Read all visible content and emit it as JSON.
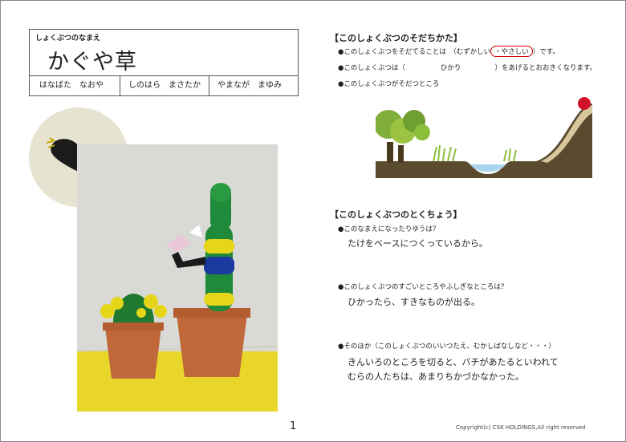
{
  "name_caption": "しょくぶつのなまえ",
  "plant_name": "かぐや草",
  "authors": [
    "はなばた　なおや",
    "しのはら　まさたか",
    "やまなが　まゆみ"
  ],
  "growth": {
    "heading": "【このしょくぶつのそだちかた】",
    "q1_prefix": "●このしょくぶつをそだてることは　（むずかしい",
    "q1_choice": "・やさしい",
    "q1_suffix": "）です。",
    "q2_prefix": "●このしょくぶつは（",
    "q2_answer": "ひかり",
    "q2_suffix": "）をあげるとおおきくなります。",
    "q3": "●このしょくぶつがそだつところ"
  },
  "features": {
    "heading": "【このしょくぶつのとくちょう】",
    "q1": "●このなまえになったりゆうは？",
    "a1": "たけをベースにつくっているから。",
    "q2": "●このしょくぶつのすごいところやふしぎなところは？",
    "a2": "ひかったら、すきなものが出る。",
    "q3": "●そのほか（このしょくぶつのいいつたえ、むかしばなしなど・・・）",
    "a3_line1": "きんいろのところを切ると、バチがあたるといわれて",
    "a3_line2": "むらの人たちは、あまりちかづかなかった。"
  },
  "page_number": "1",
  "copyright": "Copyright(c) CSK HOLDINGS,All right reserved",
  "colors": {
    "sun": "#d0122a",
    "water": "#a9d4ef",
    "ground": "#5a4a2e",
    "grass": "#8bbf3b",
    "clay_green": "#1f8a3a",
    "clay_yellow": "#e6d61a",
    "clay_blue": "#1a3aa0",
    "pot": "#c0683a",
    "table": "#e8d62a"
  }
}
